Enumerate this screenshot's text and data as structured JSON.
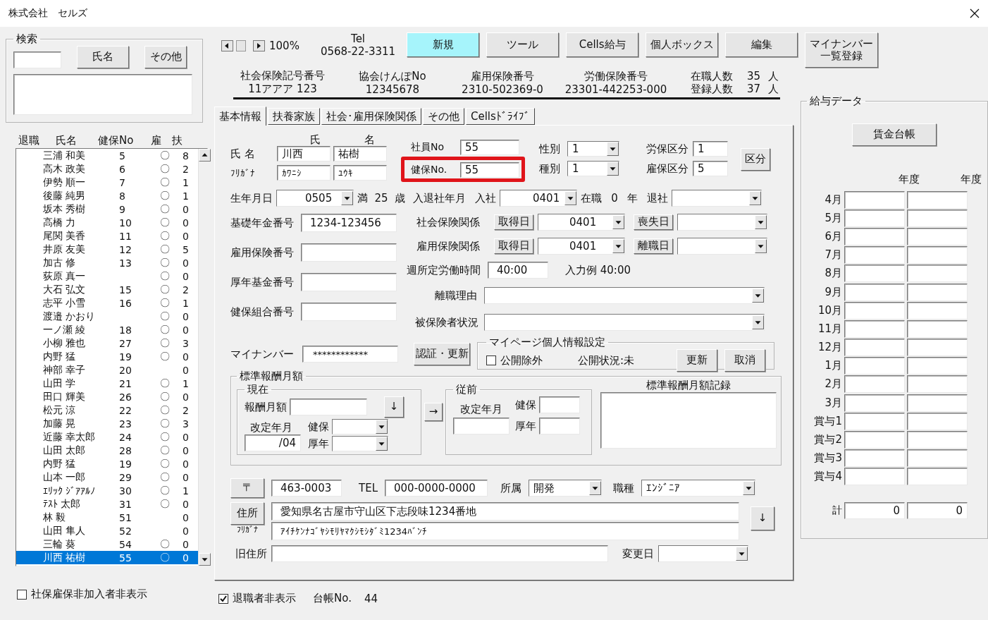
{
  "window": {
    "title": "株式会社　セルズ"
  },
  "search": {
    "title": "検索",
    "buttons": [
      "氏名",
      "その他"
    ]
  },
  "employee_list": {
    "columns": [
      "退職",
      "氏名",
      "健保No",
      "雇",
      "扶"
    ],
    "rows": [
      {
        "name": "三浦 和美",
        "no": "5",
        "koyo": "〇",
        "dependents": "8",
        "selected": false
      },
      {
        "name": "高木 政美",
        "no": "6",
        "koyo": "〇",
        "dependents": "2",
        "selected": false
      },
      {
        "name": "伊勢 順一",
        "no": "7",
        "koyo": "〇",
        "dependents": "1",
        "selected": false
      },
      {
        "name": "後藤 純男",
        "no": "8",
        "koyo": "〇",
        "dependents": "1",
        "selected": false
      },
      {
        "name": "坂本 秀樹",
        "no": "9",
        "koyo": "〇",
        "dependents": "0",
        "selected": false
      },
      {
        "name": "高橋 力",
        "no": "10",
        "koyo": "〇",
        "dependents": "0",
        "selected": false
      },
      {
        "name": "尾関 美香",
        "no": "11",
        "koyo": "〇",
        "dependents": "0",
        "selected": false
      },
      {
        "name": "井原 友美",
        "no": "12",
        "koyo": "〇",
        "dependents": "5",
        "selected": false
      },
      {
        "name": "加古 修",
        "no": "13",
        "koyo": "〇",
        "dependents": "0",
        "selected": false
      },
      {
        "name": "荻原 真一",
        "koyo": "〇",
        "dependents": "0",
        "selected": false
      },
      {
        "name": "大石 弘文",
        "no": "15",
        "koyo": "〇",
        "dependents": "2",
        "selected": false
      },
      {
        "name": "志平 小雪",
        "no": "16",
        "koyo": "〇",
        "dependents": "1",
        "selected": false
      },
      {
        "name": "渡邉 かおり",
        "koyo": "〇",
        "dependents": "0",
        "selected": false
      },
      {
        "name": "一ノ瀬 綾",
        "no": "18",
        "koyo": "〇",
        "dependents": "0",
        "selected": false
      },
      {
        "name": "小柳 雅也",
        "no": "27",
        "koyo": "〇",
        "dependents": "3",
        "selected": false
      },
      {
        "name": "内野 猛",
        "no": "19",
        "koyo": "〇",
        "dependents": "0",
        "selected": false
      },
      {
        "name": "神部 幸子",
        "no": "20",
        "dependents": "0",
        "selected": false
      },
      {
        "name": "山田 学",
        "no": "21",
        "koyo": "〇",
        "dependents": "1",
        "selected": false
      },
      {
        "name": "田口 輝美",
        "no": "26",
        "koyo": "〇",
        "dependents": "0",
        "selected": false
      },
      {
        "name": "松元 涼",
        "no": "22",
        "koyo": "〇",
        "dependents": "2",
        "selected": false
      },
      {
        "name": "加藤 晃",
        "no": "23",
        "koyo": "〇",
        "dependents": "3",
        "selected": false
      },
      {
        "name": "近藤 幸太郎",
        "no": "24",
        "koyo": "〇",
        "dependents": "0",
        "selected": false
      },
      {
        "name": "山田 太郎",
        "no": "28",
        "koyo": "〇",
        "dependents": "0",
        "selected": false
      },
      {
        "name": "内野 猛",
        "no": "19",
        "koyo": "〇",
        "dependents": "0",
        "selected": false
      },
      {
        "name": "山本 一郎",
        "no": "29",
        "koyo": "〇",
        "dependents": "0",
        "selected": false
      },
      {
        "name": "ｴﾘｯｸ ｼﾞｱｱﾙﾉ",
        "no": "30",
        "koyo": "〇",
        "dependents": "1",
        "selected": false
      },
      {
        "name": "ﾃｽﾄ 太郎",
        "no": "31",
        "koyo": "〇",
        "dependents": "0",
        "selected": false
      },
      {
        "name": "林 毅",
        "no": "51",
        "dependents": "0",
        "selected": false
      },
      {
        "name": "山田 隼人",
        "no": "52",
        "dependents": "0",
        "selected": false
      },
      {
        "name": "三輪 葵",
        "no": "54",
        "koyo": "〇",
        "dependents": "0",
        "selected": false
      },
      {
        "name": "川西 祐樹",
        "no": "55",
        "koyo": "〇",
        "dependents": "0",
        "selected": true
      }
    ]
  },
  "hide_uninsured": {
    "label": "社保雇保非加入者非表示",
    "checked": false
  },
  "toolbar": {
    "zoom": "100%",
    "tel_label": "Tel",
    "tel": "0568-22-3311",
    "buttons": [
      {
        "label": "新規",
        "highlighted": true
      },
      {
        "label": "ツール",
        "highlighted": false
      },
      {
        "label": "Cells給与",
        "highlighted": false
      },
      {
        "label": "個人ボックス",
        "highlighted": false
      },
      {
        "label": "編集",
        "highlighted": false
      },
      {
        "label": "マイナンバー一覧登録",
        "highlighted": false
      }
    ]
  },
  "company_info": [
    {
      "label": "社会保険記号番号",
      "value": "11アアア 123"
    },
    {
      "label": "協会けんぽNo",
      "value": "12345678"
    },
    {
      "label": "雇用保険番号",
      "value": "2310-502369-0"
    },
    {
      "label": "労働保険番号",
      "value": "23301-442253-000"
    }
  ],
  "headcount": [
    {
      "label": "在職人数",
      "value": "35",
      "unit": "人"
    },
    {
      "label": "登録人数",
      "value": "37",
      "unit": "人"
    }
  ],
  "tabs": [
    {
      "label": "基本情報",
      "selected": true
    },
    {
      "label": "扶養家族",
      "selected": false
    },
    {
      "label": "社会･雇用保険関係",
      "selected": false
    },
    {
      "label": "その他",
      "selected": false
    },
    {
      "label": "Cellsﾄﾞﾗｲﾌﾞ",
      "selected": false
    }
  ],
  "basic": {
    "name_headers": [
      "氏",
      "名"
    ],
    "name_label": "氏 名",
    "last_name": "川西",
    "first_name": "祐樹",
    "kana_label": "ﾌﾘｶﾞﾅ",
    "last_kana": "ｶﾜﾆｼ",
    "first_kana": "ﾕｳｷ",
    "employee_no": {
      "label": "社員No",
      "value": "55"
    },
    "health_no": {
      "label": "健保No.",
      "value": "55",
      "highlighted": true
    },
    "gender": {
      "label": "性別",
      "value": "1"
    },
    "category": {
      "label": "種別",
      "value": "1"
    },
    "labor_class": {
      "label": "労保区分",
      "value": "1"
    },
    "employment_class": {
      "label": "雇保区分",
      "value": "5"
    },
    "class_button": "区分",
    "birth": {
      "label": "生年月日",
      "value": "0505"
    },
    "age": {
      "prefix": "満",
      "value": "25",
      "unit": "歳"
    },
    "join_leave_label": "入退社年月",
    "join": {
      "label": "入社",
      "value": "0401"
    },
    "tenure": {
      "label": "在職",
      "value": "0",
      "unit": "年"
    },
    "leave": {
      "label": "退社"
    },
    "numbers": [
      {
        "label": "基礎年金番号",
        "value": "1234-123456"
      },
      {
        "label": "雇用保険番号"
      },
      {
        "label": "厚年基金番号"
      },
      {
        "label": "健保組合番号"
      }
    ],
    "insurance": [
      {
        "label": "社会保険関係",
        "acquire": "取得日",
        "acquire_date": "0401",
        "lose": "喪失日"
      },
      {
        "label": "雇用保険関係",
        "acquire": "取得日",
        "acquire_date": "0401",
        "lose": "離職日"
      }
    ],
    "weekly_hours": {
      "label": "週所定労働時間",
      "value": "40:00",
      "example": "入力例  40:00"
    },
    "reason": {
      "label": "離職理由"
    },
    "status": {
      "label": "被保険者状況"
    },
    "my_number": {
      "label": "マイナンバー",
      "value": "************",
      "button": "認証・更新"
    },
    "mypage": {
      "title": "マイページ個人情報設定",
      "checkbox": {
        "label": "公開除外",
        "checked": false
      },
      "status": "公開状況:未",
      "buttons": [
        "更新",
        "取消"
      ]
    },
    "standard_pay": {
      "title": "標準報酬月額",
      "current": {
        "title": "現在",
        "pay_label": "報酬月額",
        "down": "↓",
        "revised_label": "改定年月",
        "revised": "/04",
        "health_label": "健保",
        "pension_label": "厚年"
      },
      "move": "→",
      "previous": {
        "title": "従前",
        "revised_label": "改定年月",
        "health_label": "健保",
        "pension_label": "厚年"
      },
      "record_label": "標準報酬月額記録"
    },
    "address": {
      "zip_button": "〒",
      "zip": "463-0003",
      "tel_label": "TEL",
      "tel": "000-0000-0000",
      "dept_label": "所属",
      "dept": "開発",
      "job_label": "職種",
      "job": "ｴﾝｼﾞﾆｱ",
      "address_button": "住所",
      "address": "愛知県名古屋市守山区下志段味1234番地",
      "kana_label": "ﾌﾘｶﾞﾅ",
      "kana": "ｱｲﾁｹﾝﾅｺﾞﾔｼﾓﾘﾔﾏｸｼﾓｼﾀﾞﾐ1234ﾊﾞﾝﾁ",
      "down": "↓",
      "old_label": "旧住所",
      "changed_label": "変更日"
    }
  },
  "hide_retired": {
    "label": "退職者非表示",
    "checked": true
  },
  "ledger": {
    "label": "台帳No.",
    "value": "44"
  },
  "pay_data": {
    "title": "給与データ",
    "button": "賃金台帳",
    "year_headers": [
      "年度",
      "年度"
    ],
    "rows": [
      "4月",
      "5月",
      "6月",
      "7月",
      "8月",
      "9月",
      "10月",
      "11月",
      "12月",
      "1月",
      "2月",
      "3月",
      "賞与1",
      "賞与2",
      "賞与3",
      "賞与4"
    ],
    "total": {
      "label": "計",
      "values": [
        "0",
        "0"
      ]
    }
  }
}
